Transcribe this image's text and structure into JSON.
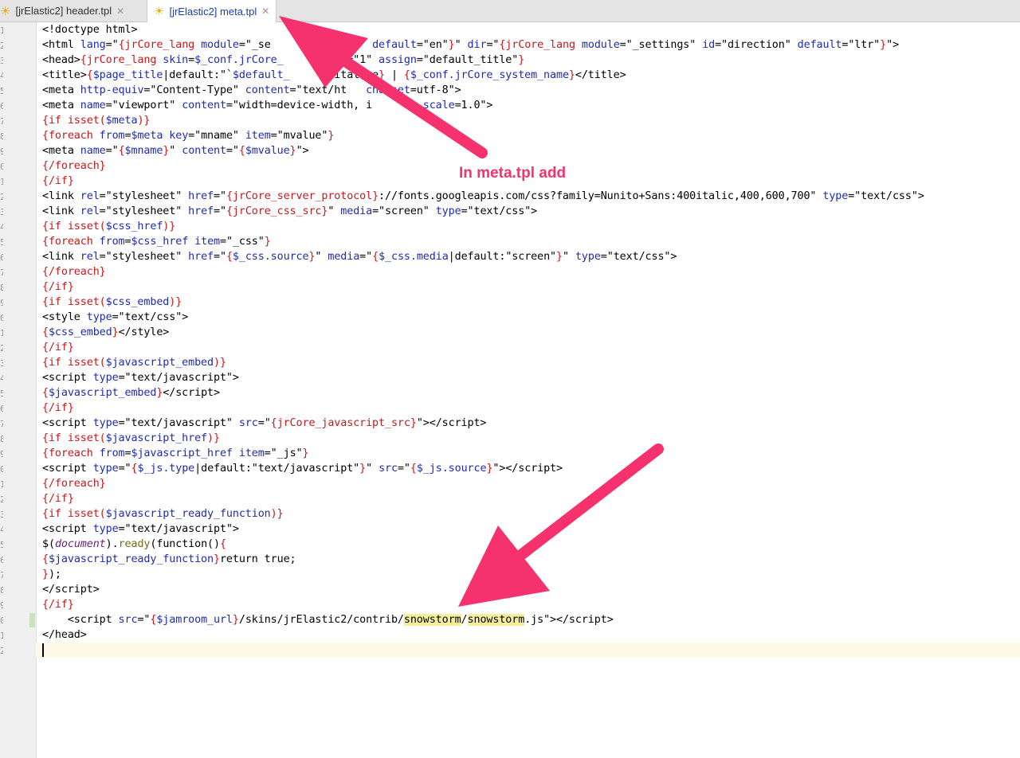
{
  "tabs": [
    {
      "label": "[jrElastic2] header.tpl",
      "icon": "sun-icon",
      "active": false
    },
    {
      "label": "[jrElastic2] meta.tpl",
      "icon": "sun-icon",
      "active": true
    }
  ],
  "annotation": "In meta.tpl add",
  "colors": {
    "arrow": "#f5326e",
    "accent": "#1a3fb0"
  },
  "lines": [
    "<!doctype html>",
    "<html lang=\"{jrCore_lang module=\"_se       d=\"lang\" default=\"en\"}\" dir=\"{jrCore_lang module=\"_settings\" id=\"direction\" default=\"ltr\"}\">",
    "<head>{jrCore_lang skin=$_conf.jrCore_     in id=\"1\" assign=\"default_title\"}",
    "<title>{$page_title|default:\"`$default_      pitalize} | {$_conf.jrCore_system_name}</title>",
    "<meta http-equiv=\"Content-Type\" content=\"text/ht   charset=utf-8\">",
    "<meta name=\"viewport\" content=\"width=device-width, i     al-scale=1.0\">",
    "{if isset($meta)}",
    "{foreach from=$meta key=\"mname\" item=\"mvalue\"}",
    "<meta name=\"{$mname}\" content=\"{$mvalue}\">",
    "{/foreach}",
    "{/if}",
    "<link rel=\"stylesheet\" href=\"{jrCore_server_protocol}://fonts.googleapis.com/css?family=Nunito+Sans:400italic,400,600,700\" type=\"text/css\">",
    "<link rel=\"stylesheet\" href=\"{jrCore_css_src}\" media=\"screen\" type=\"text/css\">",
    "{if isset($css_href)}",
    "{foreach from=$css_href item=\"_css\"}",
    "<link rel=\"stylesheet\" href=\"{$_css.source}\" media=\"{$_css.media|default:\"screen\"}\" type=\"text/css\">",
    "{/foreach}",
    "{/if}",
    "{if isset($css_embed)}",
    "<style type=\"text/css\">",
    "{$css_embed}</style>",
    "{/if}",
    "{if isset($javascript_embed)}",
    "<script type=\"text/javascript\">",
    "{$javascript_embed}</script>",
    "{/if}",
    "<script type=\"text/javascript\" src=\"{jrCore_javascript_src}\"></script>",
    "{if isset($javascript_href)}",
    "{foreach from=$javascript_href item=\"_js\"}",
    "<script type=\"{$_js.type|default:\"text/javascript\"}\" src=\"{$_js.source}\"></script>",
    "{/foreach}",
    "{/if}",
    "{if isset($javascript_ready_function)}",
    "<script type=\"text/javascript\">",
    "$(document).ready(function(){",
    "{$javascript_ready_function}return true;",
    "});",
    "</script>",
    "{/if}",
    "    <script src=\"{$jamroom_url}/skins/jrElastic2/contrib/snowstorm/snowstorm.js\"></script>",
    "</head>",
    ""
  ]
}
